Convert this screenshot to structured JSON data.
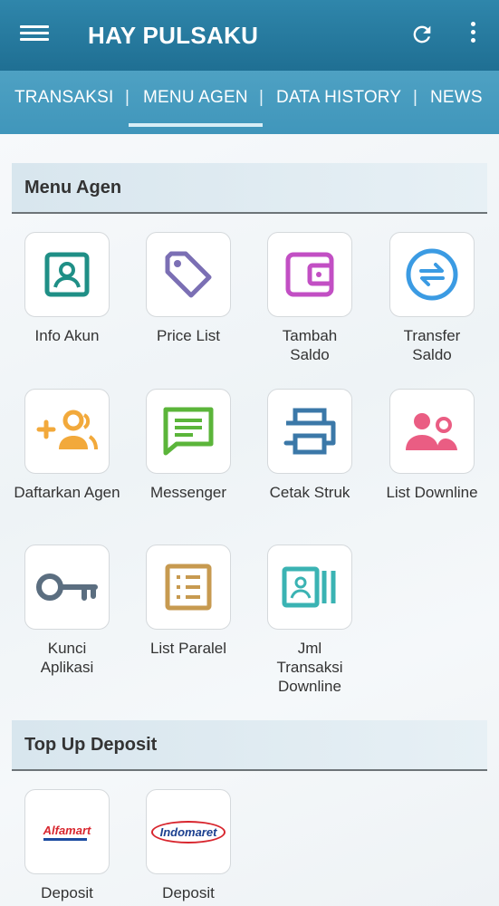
{
  "appbar": {
    "title": "HAY PULSAKU"
  },
  "tabs": [
    {
      "label": "TRANSAKSI"
    },
    {
      "label": "MENU AGEN",
      "active": true
    },
    {
      "label": "DATA HISTORY"
    },
    {
      "label": "NEWS"
    }
  ],
  "tab_separator": "|",
  "sections": {
    "menu_agen": {
      "title": "Menu Agen",
      "items": [
        {
          "label": "Info Akun",
          "icon": "account-card-icon",
          "color": "#1f8f86"
        },
        {
          "label": "Price List",
          "icon": "price-tag-icon",
          "color": "#7b6fb4"
        },
        {
          "label": "Tambah Saldo",
          "icon": "wallet-icon",
          "color": "#c24fc4"
        },
        {
          "label": "Transfer Saldo",
          "icon": "transfer-icon",
          "color": "#3b9be3"
        },
        {
          "label": "Daftarkan Agen",
          "icon": "add-user-icon",
          "color": "#f2a93b"
        },
        {
          "label": "Messenger",
          "icon": "message-icon",
          "color": "#5bb53a"
        },
        {
          "label": "Cetak Struk",
          "icon": "printer-icon",
          "color": "#3b78a8"
        },
        {
          "label": "List Downline",
          "icon": "users-icon",
          "color": "#ea5d83"
        },
        {
          "label": "Kunci Aplikasi",
          "icon": "key-icon",
          "color": "#5b6e80"
        },
        {
          "label": "List Paralel",
          "icon": "list-icon",
          "color": "#c79a50"
        },
        {
          "label": "Jml Transaksi Downline",
          "icon": "contact-bars-icon",
          "color": "#3ab3b3"
        }
      ]
    },
    "top_up": {
      "title": "Top Up Deposit",
      "items": [
        {
          "label": "Deposit",
          "brand": "Alfamart",
          "icon": "alfamart-logo"
        },
        {
          "label": "Deposit",
          "brand": "Indomaret",
          "icon": "indomaret-logo"
        }
      ]
    }
  }
}
